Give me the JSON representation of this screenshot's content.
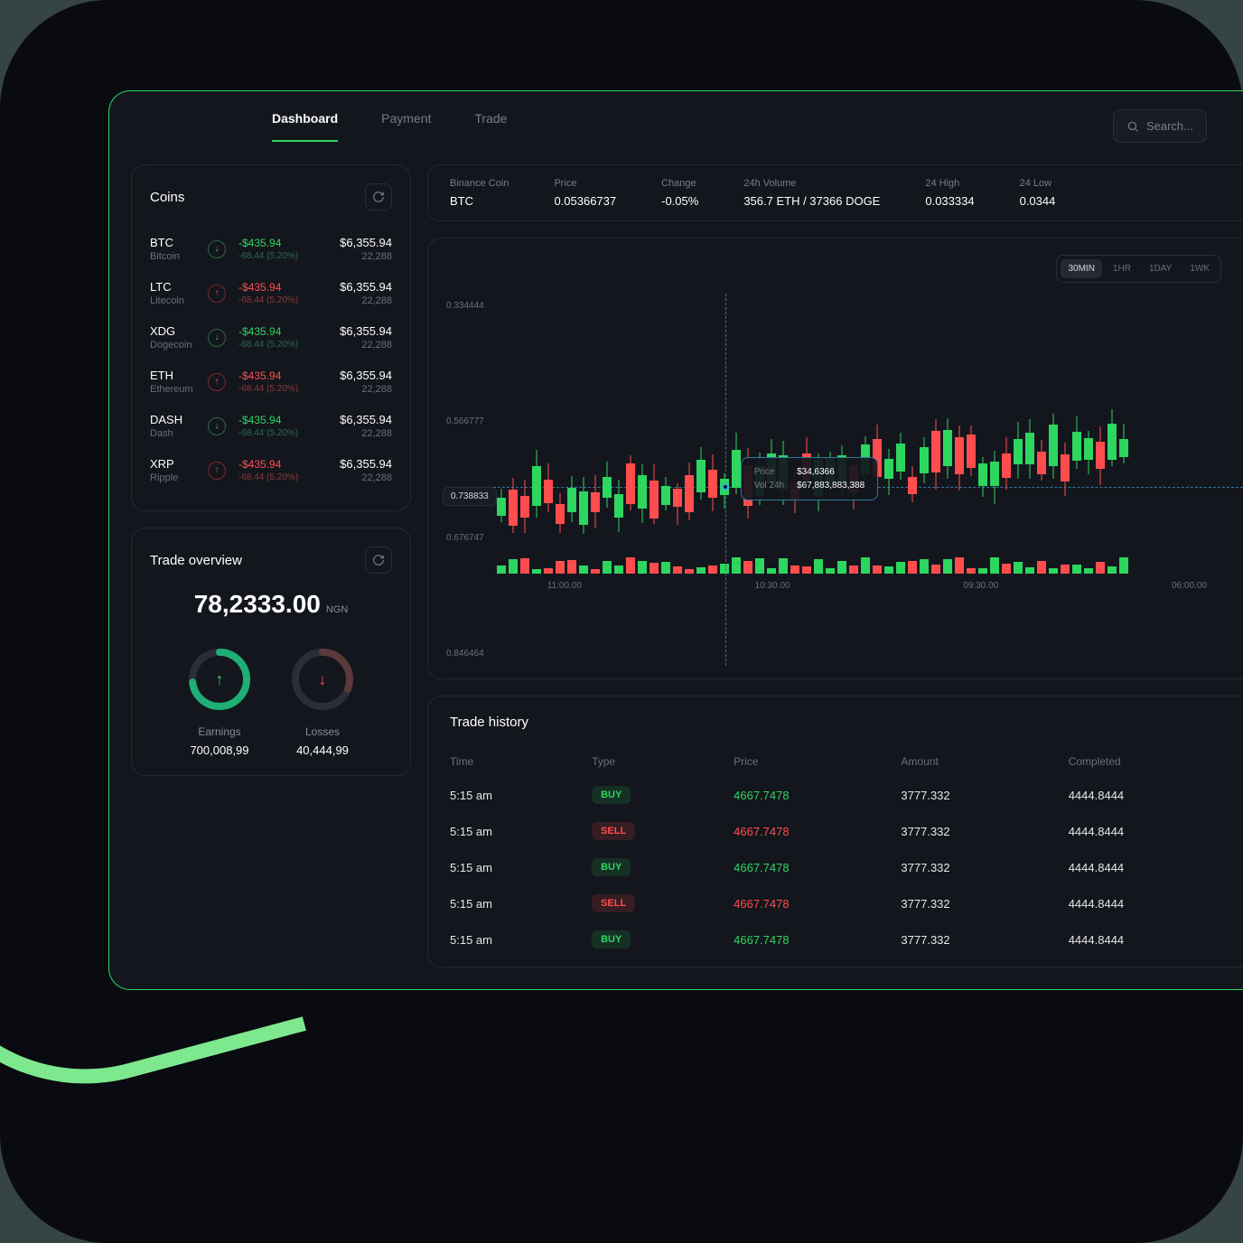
{
  "nav": {
    "tabs": [
      "Dashboard",
      "Payment",
      "Trade"
    ],
    "active": 0
  },
  "search": {
    "placeholder": "Search..."
  },
  "coins_panel": {
    "title": "Coins",
    "rows": [
      {
        "symbol": "BTC",
        "name": "Bitcoin",
        "dir": "up",
        "delta": "-$435.94",
        "sub": "-68.44 (5.20%)",
        "price": "$6,355.94",
        "vol": "22,288"
      },
      {
        "symbol": "LTC",
        "name": "Litecoin",
        "dir": "down",
        "delta": "-$435.94",
        "sub": "-68.44 (5.20%)",
        "price": "$6,355.94",
        "vol": "22,288"
      },
      {
        "symbol": "XDG",
        "name": "Dogecoin",
        "dir": "up",
        "delta": "-$435.94",
        "sub": "-68.44 (5.20%)",
        "price": "$6,355.94",
        "vol": "22,288"
      },
      {
        "symbol": "ETH",
        "name": "Ethereum",
        "dir": "down",
        "delta": "-$435.94",
        "sub": "-68.44 (5.20%)",
        "price": "$6,355.94",
        "vol": "22,288"
      },
      {
        "symbol": "DASH",
        "name": "Dash",
        "dir": "up",
        "delta": "-$435.94",
        "sub": "-68.44 (5.20%)",
        "price": "$6,355.94",
        "vol": "22,288"
      },
      {
        "symbol": "XRP",
        "name": "Ripple",
        "dir": "down",
        "delta": "-$435.94",
        "sub": "-68.44 (5.20%)",
        "price": "$6,355.94",
        "vol": "22,288"
      }
    ]
  },
  "overview": {
    "title": "Trade overview",
    "amount": "78,2333.00",
    "currency": "NGN",
    "earnings_label": "Earnings",
    "earnings_value": "700,008,99",
    "losses_label": "Losses",
    "losses_value": "40,444,99"
  },
  "stats": {
    "coin_label": "Binance Coin",
    "coin_symbol": "BTC",
    "price_label": "Price",
    "price_value": "0.05366737",
    "change_label": "Change",
    "change_value": "-0.05%",
    "vol_label": "24h Volume",
    "vol_value": "356.7 ETH / 37366 DOGE",
    "high_label": "24 High",
    "high_value": "0.033334",
    "low_label": "24 Low",
    "low_value": "0.0344"
  },
  "chart": {
    "timeframes": [
      "30MIN",
      "1HR",
      "1DAY",
      "1WK"
    ],
    "active_tf": 0,
    "y_ticks": [
      "0.334444",
      "0.566777",
      "0.676747",
      "0.846464"
    ],
    "y_marker": "0.738833",
    "x_ticks": [
      "11:00.00",
      "10:30.00",
      "09:30.00",
      "06:00.00"
    ],
    "tooltip": {
      "price_label": "Price",
      "price_value": "$34,6366",
      "vol_label": "Vol 24h",
      "vol_value": "$67,883,883,388"
    }
  },
  "history": {
    "title": "Trade history",
    "headers": {
      "time": "Time",
      "type": "Type",
      "price": "Price",
      "amount": "Amount",
      "completed": "Completed"
    },
    "rows": [
      {
        "time": "5:15 am",
        "type": "BUY",
        "price": "4667.7478",
        "amount": "3777.332",
        "completed": "4444.8444"
      },
      {
        "time": "5:15 am",
        "type": "SELL",
        "price": "4667.7478",
        "amount": "3777.332",
        "completed": "4444.8444"
      },
      {
        "time": "5:15 am",
        "type": "BUY",
        "price": "4667.7478",
        "amount": "3777.332",
        "completed": "4444.8444"
      },
      {
        "time": "5:15 am",
        "type": "SELL",
        "price": "4667.7478",
        "amount": "3777.332",
        "completed": "4444.8444"
      },
      {
        "time": "5:15 am",
        "type": "BUY",
        "price": "4667.7478",
        "amount": "3777.332",
        "completed": "4444.8444"
      }
    ]
  },
  "chart_data": {
    "type": "candlestick",
    "title": "",
    "y_ticks": [
      0.334444,
      0.566777,
      0.676747,
      0.846464
    ],
    "y_marker": 0.738833,
    "x_labels": [
      "11:00.00",
      "10:30.00",
      "09:30.00",
      "06:00.00"
    ],
    "tooltip": {
      "price": 34.6366,
      "vol_24h": 67883883388
    },
    "candles_dir": [
      "g",
      "r",
      "r",
      "g",
      "r",
      "r",
      "g",
      "g",
      "r",
      "g",
      "g",
      "r",
      "g",
      "r",
      "g",
      "r",
      "r",
      "g",
      "r",
      "g",
      "g",
      "r",
      "g",
      "g",
      "g",
      "r",
      "r",
      "g",
      "g",
      "g",
      "r",
      "g",
      "r",
      "g",
      "g",
      "r",
      "g",
      "r",
      "g",
      "r",
      "r",
      "g",
      "g",
      "r",
      "g",
      "g",
      "r",
      "g",
      "r",
      "g",
      "g",
      "r",
      "g",
      "g"
    ],
    "volume_dir": [
      "g",
      "g",
      "r",
      "g",
      "r",
      "r",
      "r",
      "g",
      "r",
      "g",
      "g",
      "r",
      "g",
      "r",
      "g",
      "r",
      "r",
      "g",
      "r",
      "g",
      "g",
      "r",
      "g",
      "g",
      "g",
      "r",
      "r",
      "g",
      "g",
      "g",
      "r",
      "g",
      "r",
      "g",
      "g",
      "r",
      "g",
      "r",
      "g",
      "r",
      "r",
      "g",
      "g",
      "r",
      "g",
      "g",
      "r",
      "g",
      "r",
      "g",
      "g",
      "r",
      "g",
      "g"
    ]
  }
}
